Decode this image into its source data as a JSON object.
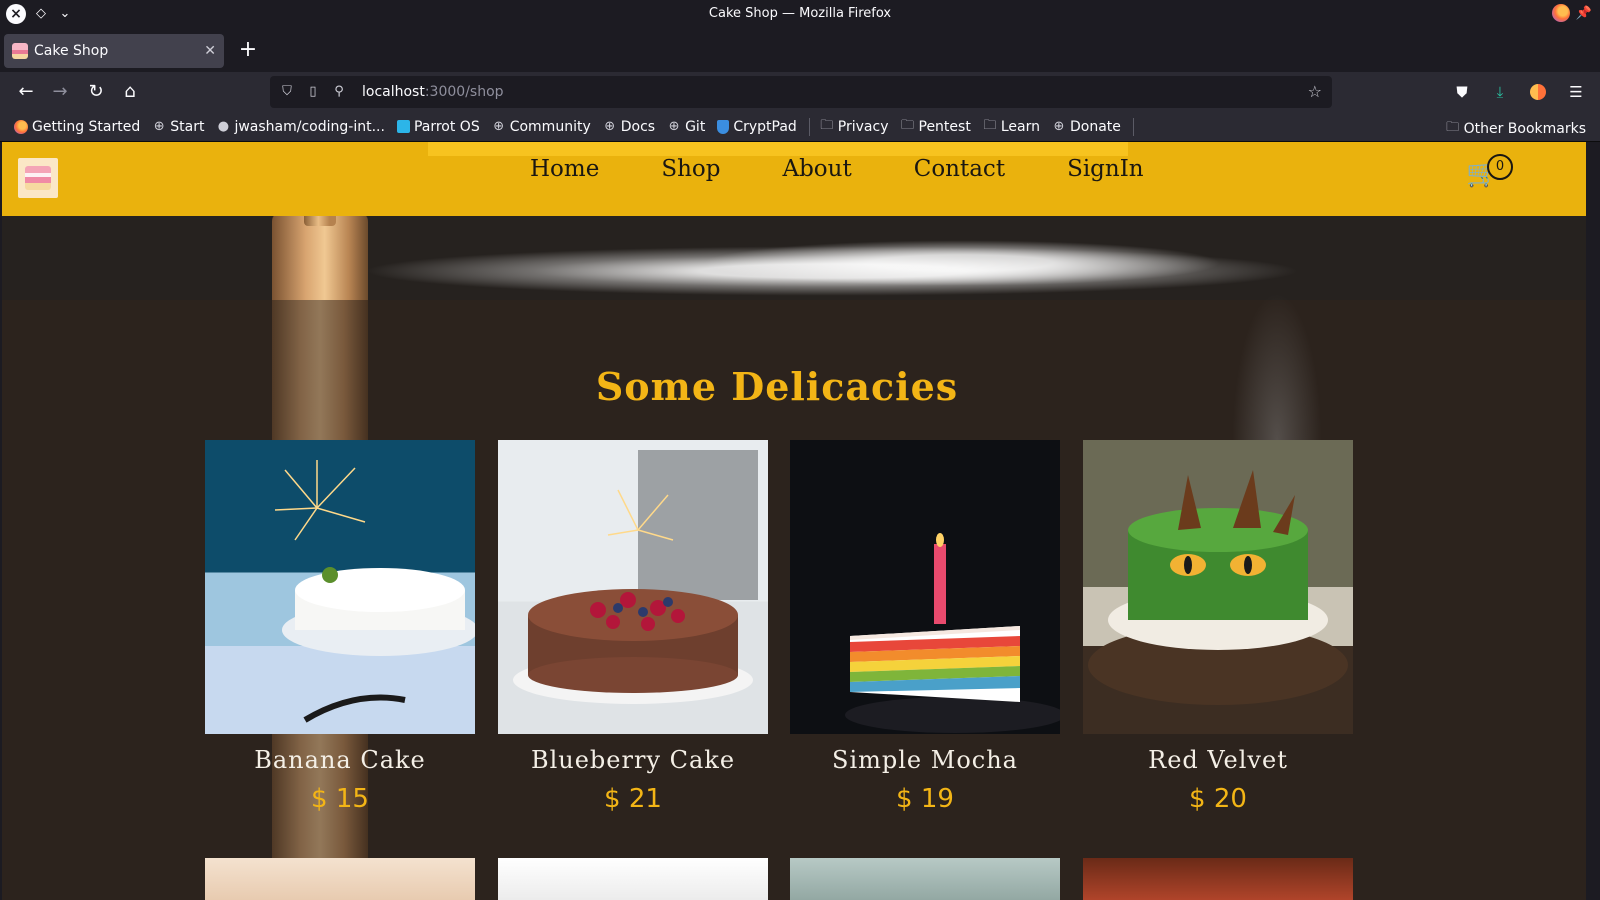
{
  "window": {
    "title": "Cake Shop — Mozilla Firefox"
  },
  "tabs": [
    {
      "title": "Cake Shop",
      "favicon": "cake-favicon"
    }
  ],
  "urlbar": {
    "host": "localhost",
    "path": ":3000/shop"
  },
  "bookmarks": [
    {
      "label": "Getting Started",
      "icon": "firefox-icon"
    },
    {
      "label": "Start",
      "icon": "globe-icon"
    },
    {
      "label": "jwasham/coding-int...",
      "icon": "github-icon"
    },
    {
      "label": "Parrot OS",
      "icon": "parrot-icon"
    },
    {
      "label": "Community",
      "icon": "globe-icon"
    },
    {
      "label": "Docs",
      "icon": "globe-icon"
    },
    {
      "label": "Git",
      "icon": "globe-icon"
    },
    {
      "label": "CryptPad",
      "icon": "cryptpad-icon"
    },
    {
      "label": "Privacy",
      "icon": "folder-icon"
    },
    {
      "label": "Pentest",
      "icon": "folder-icon"
    },
    {
      "label": "Learn",
      "icon": "folder-icon"
    },
    {
      "label": "Donate",
      "icon": "globe-icon"
    }
  ],
  "other_bookmarks": "Other Bookmarks",
  "site": {
    "nav": [
      "Home",
      "Shop",
      "About",
      "Contact",
      "SignIn"
    ],
    "cart_count": "0",
    "section_title": "Some Delicacies",
    "products": [
      {
        "name": "Banana Cake",
        "price": "$ 15"
      },
      {
        "name": "Blueberry Cake",
        "price": "$ 21"
      },
      {
        "name": "Simple Mocha",
        "price": "$ 19"
      },
      {
        "name": "Red Velvet",
        "price": "$ 20"
      }
    ]
  },
  "colors": {
    "header_yellow": "#eab20d",
    "accent_gold": "#f3b516",
    "page_brown": "#2c231d"
  }
}
